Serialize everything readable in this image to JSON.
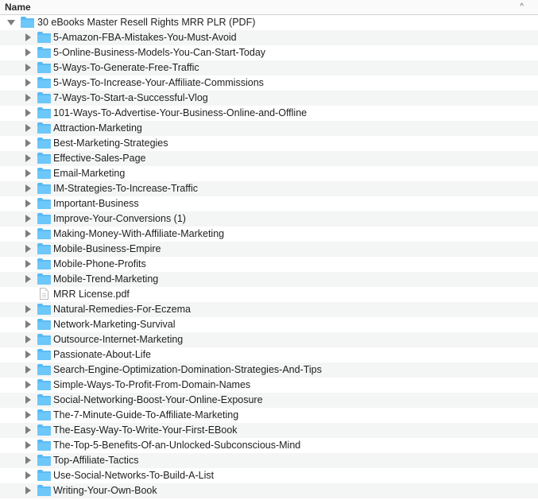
{
  "header": {
    "name_column": "Name",
    "sort_indicator": "^"
  },
  "root": {
    "label": "30 eBooks  Master Resell Rights MRR PLR (PDF)",
    "icon": "folder-icon",
    "expanded": true
  },
  "items": [
    {
      "label": "5-Amazon-FBA-Mistakes-You-Must-Avoid",
      "type": "folder"
    },
    {
      "label": "5-Online-Business-Models-You-Can-Start-Today",
      "type": "folder"
    },
    {
      "label": "5-Ways-To-Generate-Free-Traffic",
      "type": "folder"
    },
    {
      "label": "5-Ways-To-Increase-Your-Affiliate-Commissions",
      "type": "folder"
    },
    {
      "label": "7-Ways-To-Start-a-Successful-Vlog",
      "type": "folder"
    },
    {
      "label": "101-Ways-To-Advertise-Your-Business-Online-and-Offline",
      "type": "folder"
    },
    {
      "label": "Attraction-Marketing",
      "type": "folder"
    },
    {
      "label": "Best-Marketing-Strategies",
      "type": "folder"
    },
    {
      "label": "Effective-Sales-Page",
      "type": "folder"
    },
    {
      "label": "Email-Marketing",
      "type": "folder"
    },
    {
      "label": "IM-Strategies-To-Increase-Traffic",
      "type": "folder"
    },
    {
      "label": "Important-Business",
      "type": "folder"
    },
    {
      "label": "Improve-Your-Conversions (1)",
      "type": "folder"
    },
    {
      "label": "Making-Money-With-Affiliate-Marketing",
      "type": "folder"
    },
    {
      "label": "Mobile-Business-Empire",
      "type": "folder"
    },
    {
      "label": "Mobile-Phone-Profits",
      "type": "folder"
    },
    {
      "label": "Mobile-Trend-Marketing",
      "type": "folder"
    },
    {
      "label": "MRR License.pdf",
      "type": "file"
    },
    {
      "label": "Natural-Remedies-For-Eczema",
      "type": "folder"
    },
    {
      "label": "Network-Marketing-Survival",
      "type": "folder"
    },
    {
      "label": "Outsource-Internet-Marketing",
      "type": "folder"
    },
    {
      "label": "Passionate-About-Life",
      "type": "folder"
    },
    {
      "label": "Search-Engine-Optimization-Domination-Strategies-And-Tips",
      "type": "folder"
    },
    {
      "label": "Simple-Ways-To-Profit-From-Domain-Names",
      "type": "folder"
    },
    {
      "label": "Social-Networking-Boost-Your-Online-Exposure",
      "type": "folder"
    },
    {
      "label": "The-7-Minute-Guide-To-Affiliate-Marketing",
      "type": "folder"
    },
    {
      "label": "The-Easy-Way-To-Write-Your-First-EBook",
      "type": "folder"
    },
    {
      "label": "The-Top-5-Benefits-Of-an-Unlocked-Subconscious-Mind",
      "type": "folder"
    },
    {
      "label": "Top-Affiliate-Tactics",
      "type": "folder"
    },
    {
      "label": "Use-Social-Networks-To-Build-A-List",
      "type": "folder"
    },
    {
      "label": "Writing-Your-Own-Book",
      "type": "folder"
    }
  ],
  "colors": {
    "folder": "#5bbcf5",
    "row_alt": "#f4f5f5",
    "disclosure": "#7d7d7d"
  }
}
